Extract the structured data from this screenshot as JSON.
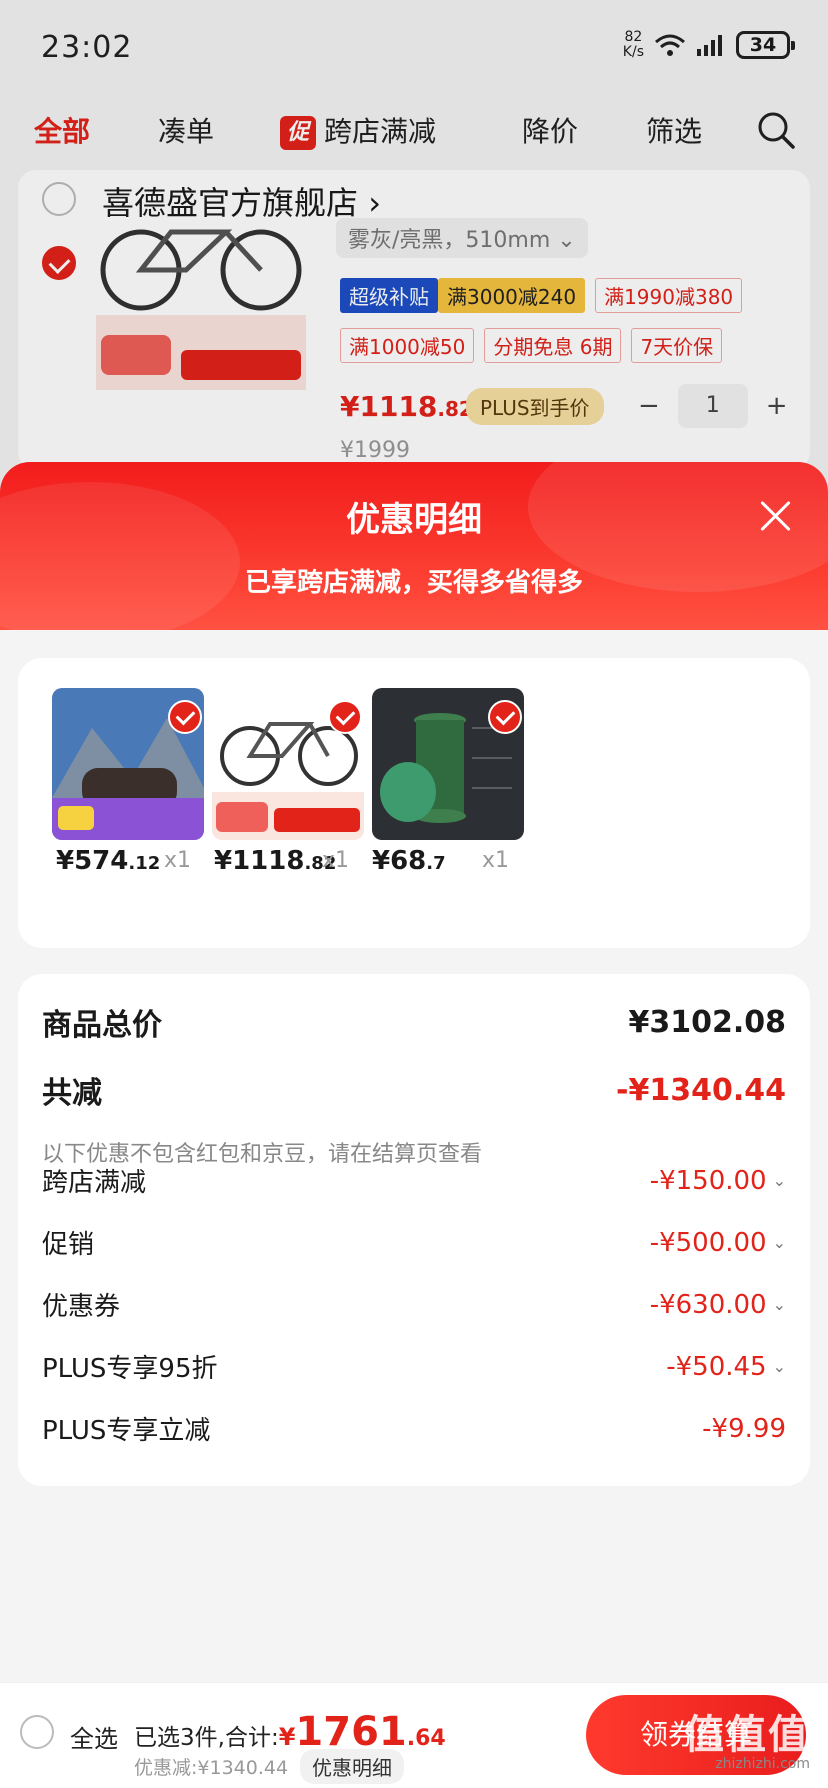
{
  "status_bar": {
    "time": "23:02",
    "net_speed_top": "82",
    "net_speed_unit": "K/s",
    "battery": "34"
  },
  "top_tabs": [
    {
      "label": "全部",
      "active": true
    },
    {
      "label": "凑单",
      "active": false
    },
    {
      "badge": "促",
      "label": "跨店满减",
      "active": false
    },
    {
      "label": "降价",
      "active": false
    },
    {
      "label": "筛选",
      "active": false
    }
  ],
  "cart_item": {
    "shop_name": "喜德盛官方旗舰店",
    "spec": "雾灰/亮黑，510mm",
    "tags_row1": [
      "超级补贴",
      "满3000减240",
      "满1990减380"
    ],
    "tags_row2": [
      "满1000减50",
      "分期免息",
      "6期",
      "7天价保"
    ],
    "price_int": "¥1118",
    "price_dec": ".82",
    "plus_label": "PLUS到手价",
    "quantity": "1",
    "original_price": "¥1999"
  },
  "sheet": {
    "title": "优惠明细",
    "subtitle": "已享跨店满减，买得多省得多",
    "products": [
      {
        "price_int": "¥574",
        "price_dec": ".12",
        "qty": "x1"
      },
      {
        "price_int": "¥1118",
        "price_dec": ".82",
        "qty": "x1"
      },
      {
        "price_int": "¥68",
        "price_dec": ".7",
        "qty": "x1"
      }
    ],
    "summary": {
      "total_label": "商品总价",
      "total_value": "¥3102.08",
      "discount_label": "共减",
      "discount_value": "-¥1340.44",
      "note": "以下优惠不包含红包和京豆，请在结算页查看",
      "items": [
        {
          "label": "跨店满减",
          "value": "-¥150.00",
          "expandable": true
        },
        {
          "label": "促销",
          "value": "-¥500.00",
          "expandable": true
        },
        {
          "label": "优惠券",
          "value": "-¥630.00",
          "expandable": true
        },
        {
          "label": "PLUS专享95折",
          "value": "-¥50.45",
          "expandable": true
        },
        {
          "label": "PLUS专享立减",
          "value": "-¥9.99",
          "expandable": false
        }
      ]
    }
  },
  "bottom_bar": {
    "select_all": "全选",
    "selected_text": "已选3件,合计:",
    "total_currency": "¥",
    "total_int": "1761",
    "total_dec": ".64",
    "discount_text": "优惠减:¥1340.44",
    "detail_button": "优惠明细",
    "checkout_button": "领券结算",
    "watermark": "值值值",
    "watermark_url": "zhizhizhi.com"
  },
  "colors": {
    "accent": "#e2231a",
    "plus_gold": "#f7e0a3"
  }
}
